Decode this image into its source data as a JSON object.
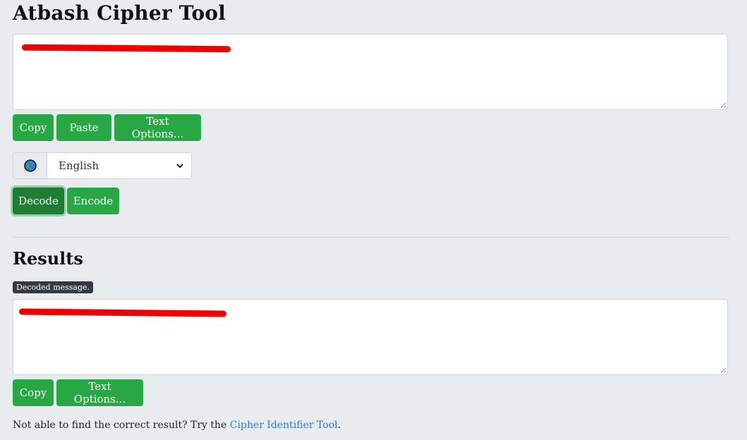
{
  "page": {
    "title": "Atbash Cipher Tool"
  },
  "input": {
    "value": ""
  },
  "input_buttons": {
    "copy": "Copy",
    "paste": "Paste",
    "text_options": "Text Options..."
  },
  "language": {
    "selected": "English",
    "icon": "globe-icon"
  },
  "actions": {
    "decode": "Decode",
    "encode": "Encode",
    "active": "decode"
  },
  "results": {
    "heading": "Results",
    "badge": "Decoded message.",
    "value": "",
    "buttons": {
      "copy": "Copy",
      "text_options": "Text Options..."
    }
  },
  "footer": {
    "prefix": "Not able to find the correct result? Try the ",
    "link": "Cipher Identifier Tool",
    "suffix": "."
  },
  "colors": {
    "primary_button": "#28a745",
    "active_button": "#1e7e34",
    "link": "#2f7ad6",
    "redaction": "#ee0000",
    "background": "#e9ecef"
  }
}
